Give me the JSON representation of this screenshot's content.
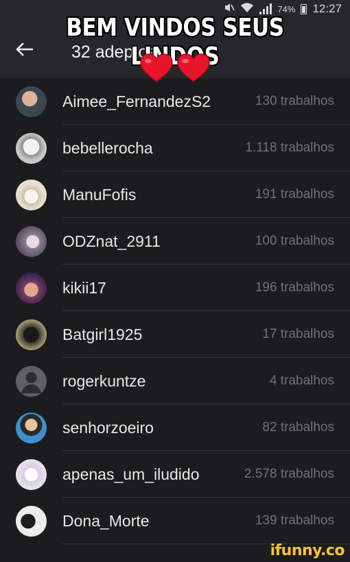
{
  "status_bar": {
    "battery_text": "74%",
    "time": "12:27",
    "icons": [
      "mute-icon",
      "wifi-icon",
      "signal-icon",
      "battery-icon"
    ]
  },
  "meme": {
    "caption": "BEM VINDOS SEUS LINDOS",
    "hearts": [
      "heart-emoji",
      "heart-emoji"
    ],
    "heart_color": "#e8142a"
  },
  "app_bar": {
    "title": "32 adeptos",
    "back_icon": "arrow-left-icon"
  },
  "members": [
    {
      "name": "Aimee_FernandezS2",
      "count": "130 trabalhos",
      "avatar_color": "#3b4650"
    },
    {
      "name": "bebellerocha",
      "count": "1.118 trabalhos",
      "avatar_color": "#c9c9c9"
    },
    {
      "name": "ManuFofis",
      "count": "191 trabalhos",
      "avatar_color": "#e4e0d2"
    },
    {
      "name": "ODZnat_2911",
      "count": "100 trabalhos",
      "avatar_color": "#8a7f95"
    },
    {
      "name": "kikii17",
      "count": "196 trabalhos",
      "avatar_color": "#7a3e63"
    },
    {
      "name": "Batgirl1925",
      "count": "17 trabalhos",
      "avatar_color": "#3c3a2a"
    },
    {
      "name": "rogerkuntze",
      "count": "4 trabalhos",
      "avatar_color": "#5e6064"
    },
    {
      "name": "senhorzoeiro",
      "count": "82 trabalhos",
      "avatar_color": "#3f8fd0"
    },
    {
      "name": "apenas_um_iludido",
      "count": "2.578 trabalhos",
      "avatar_color": "#e9e4ec"
    },
    {
      "name": "Dona_Morte",
      "count": "139 trabalhos",
      "avatar_color": "#ececec"
    }
  ],
  "watermark": "ifunny.co",
  "colors": {
    "background": "#1b1c1e",
    "app_bar": "#26272a",
    "name_text": "#e8e8e8",
    "count_text": "#6f7275",
    "divider": "#34363a",
    "watermark": "#f6c531"
  }
}
